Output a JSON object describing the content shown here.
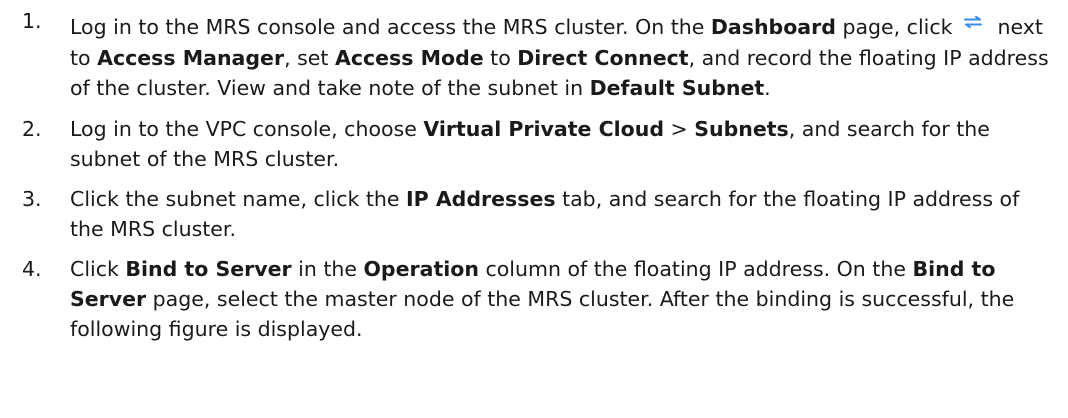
{
  "steps": [
    {
      "number": "1.",
      "parts": [
        {
          "t": "Log in to the MRS console and access the MRS cluster. On the ",
          "b": false
        },
        {
          "t": "Dashboard",
          "b": true
        },
        {
          "t": " page, click ",
          "b": false
        },
        {
          "icon": "switch-arrows-icon"
        },
        {
          "t": " next to ",
          "b": false
        },
        {
          "t": "Access Manager",
          "b": true
        },
        {
          "t": ", set ",
          "b": false
        },
        {
          "t": "Access Mode",
          "b": true
        },
        {
          "t": " to ",
          "b": false
        },
        {
          "t": "Direct Connect",
          "b": true
        },
        {
          "t": ", and record the floating IP address of the cluster. View and take note of the subnet in ",
          "b": false
        },
        {
          "t": "Default Subnet",
          "b": true
        },
        {
          "t": ".",
          "b": false
        }
      ]
    },
    {
      "number": "2.",
      "parts": [
        {
          "t": "Log in to the VPC console, choose ",
          "b": false
        },
        {
          "t": "Virtual Private Cloud",
          "b": true
        },
        {
          "t": " > ",
          "b": false
        },
        {
          "t": "Subnets",
          "b": true
        },
        {
          "t": ", and search for the subnet of the MRS cluster.",
          "b": false
        }
      ]
    },
    {
      "number": "3.",
      "parts": [
        {
          "t": "Click the subnet name, click the ",
          "b": false
        },
        {
          "t": "IP Addresses",
          "b": true
        },
        {
          "t": " tab, and search for the floating IP address of the MRS cluster.",
          "b": false
        }
      ]
    },
    {
      "number": "4.",
      "parts": [
        {
          "t": "Click ",
          "b": false
        },
        {
          "t": "Bind to Server",
          "b": true
        },
        {
          "t": " in the ",
          "b": false
        },
        {
          "t": "Operation",
          "b": true
        },
        {
          "t": " column of the floating IP address. On the ",
          "b": false
        },
        {
          "t": "Bind to Server",
          "b": true
        },
        {
          "t": " page, select the master node of the MRS cluster. After the binding is successful, the following figure is displayed.",
          "b": false
        }
      ]
    }
  ],
  "icon_color": "#3a8ee6"
}
